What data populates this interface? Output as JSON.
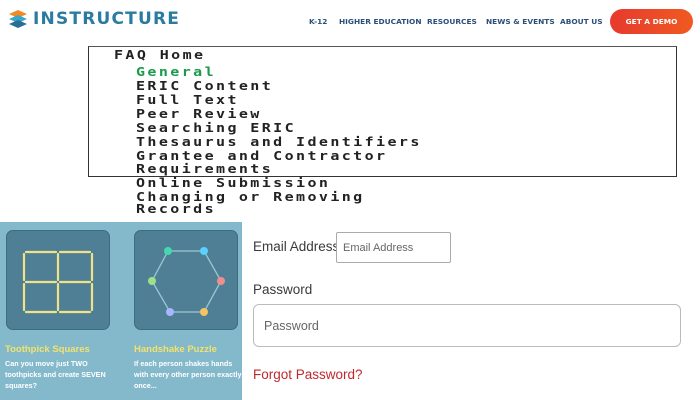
{
  "header": {
    "logo_text": "INSTRUCTURE",
    "nav": [
      "K-12",
      "HIGHER EDUCATION",
      "RESOURCES",
      "NEWS & EVENTS",
      "ABOUT US"
    ],
    "cta_label": "GET A DEMO"
  },
  "faq": {
    "lines": [
      "FAQ Home",
      "General",
      "ERIC Content",
      "Full Text",
      "Peer Review",
      "Searching ERIC",
      "Thesaurus and Identifiers",
      "Grantee and Contractor",
      "Requirements",
      "Online Submission",
      "Changing or Removing",
      "Records"
    ]
  },
  "puzzles": [
    {
      "title": "Toothpick Squares",
      "description": "Can you move just TWO toothpicks and create SEVEN squares?"
    },
    {
      "title": "Handshake Puzzle",
      "description": "If each person shakes hands with every other person exactly once..."
    }
  ],
  "login": {
    "email_label": "Email Address",
    "email_placeholder": "Email Address",
    "password_label": "Password",
    "password_placeholder": "Password",
    "forgot_label": "Forgot Password?"
  },
  "colors": {
    "brand": "#2a7ba0",
    "nav": "#2b4f78",
    "cta": "#e63a2e",
    "faq_active": "#1a9a4a",
    "puzzle_bg": "#84b9cc",
    "card_bg": "#4f7f94",
    "card_title": "#f3e26a",
    "forgot": "#c0282d"
  }
}
